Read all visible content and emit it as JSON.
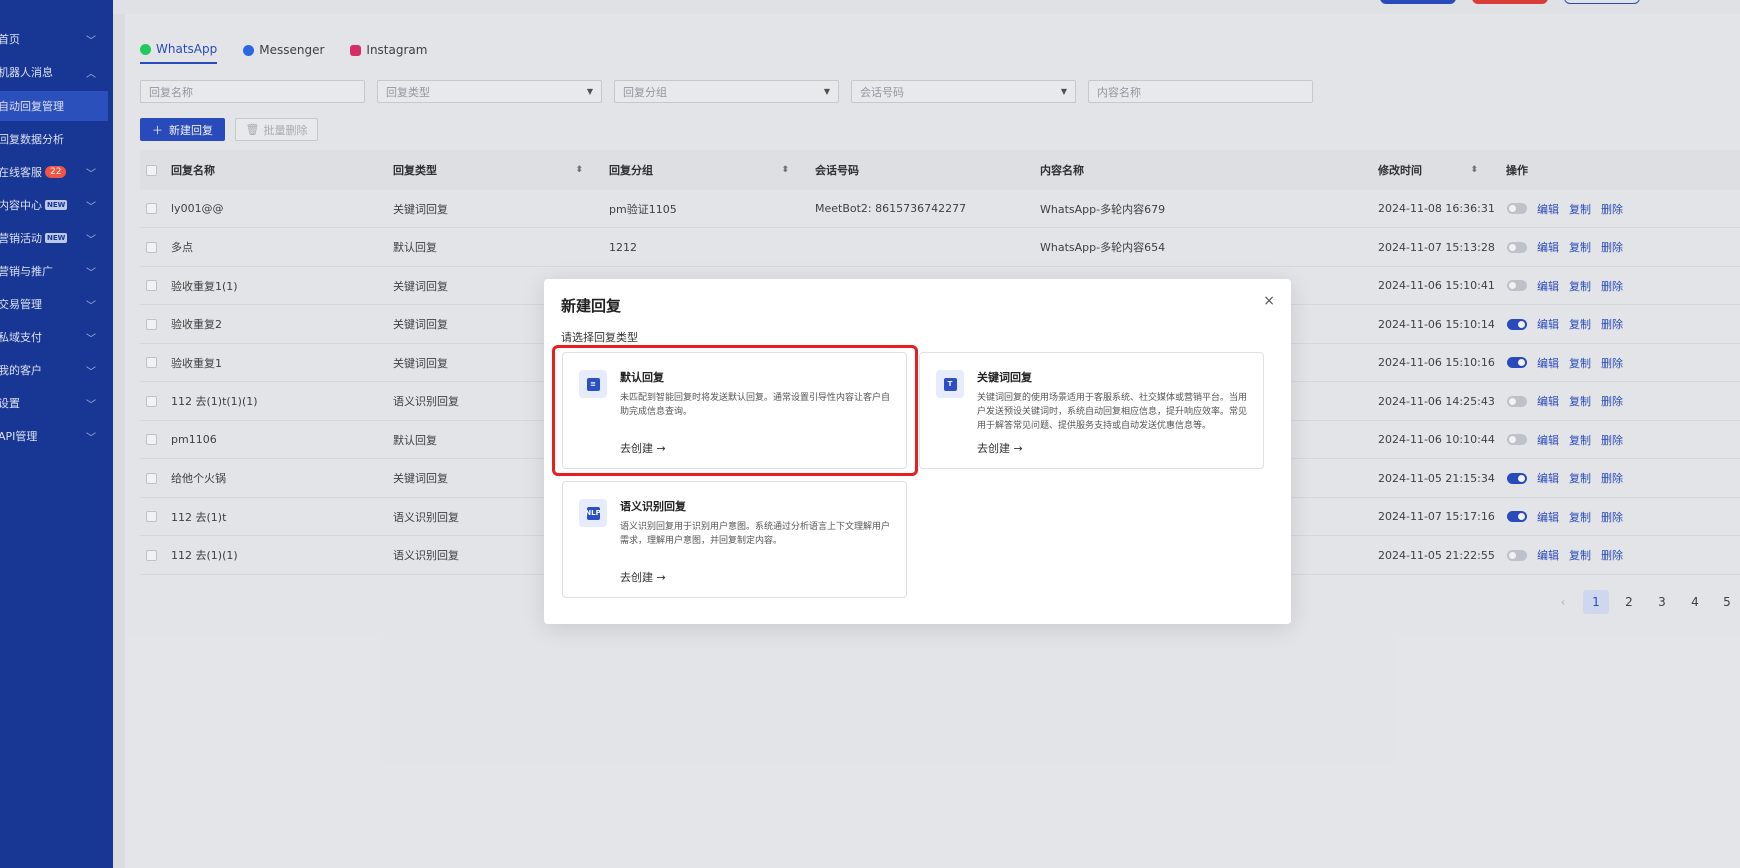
{
  "sidebar": {
    "items": [
      {
        "label": "首页",
        "chevron": "﹀"
      },
      {
        "label": "机器人消息",
        "chevron": "︿"
      },
      {
        "label": "自动回复管理",
        "chevron": ""
      },
      {
        "label": "回复数据分析",
        "chevron": ""
      },
      {
        "label": "在线客服",
        "badge": "22",
        "chevron": "﹀"
      },
      {
        "label": "内容中心",
        "new": "NEW",
        "chevron": "﹀"
      },
      {
        "label": "营销活动",
        "new": "NEW",
        "chevron": "﹀"
      },
      {
        "label": "营销与推广",
        "chevron": "﹀"
      },
      {
        "label": "交易管理",
        "chevron": "﹀"
      },
      {
        "label": "私域支付",
        "chevron": "﹀"
      },
      {
        "label": "我的客户",
        "chevron": "﹀"
      },
      {
        "label": "设置",
        "chevron": "﹀"
      },
      {
        "label": "API管理",
        "chevron": "﹀"
      }
    ]
  },
  "tabs": [
    {
      "label": "WhatsApp",
      "color": "#25d366"
    },
    {
      "label": "Messenger",
      "color": "#2b6ff0"
    },
    {
      "label": "Instagram",
      "color": "#e1306c"
    }
  ],
  "filters": {
    "name_placeholder": "回复名称",
    "type_placeholder": "回复类型",
    "group_placeholder": "回复分组",
    "number_placeholder": "会话号码",
    "content_placeholder": "内容名称"
  },
  "toolbar": {
    "new_label": "新建回复",
    "batch_delete_label": "批量删除"
  },
  "table": {
    "headers": {
      "name": "回复名称",
      "type": "回复类型",
      "group": "回复分组",
      "number": "会话号码",
      "content": "内容名称",
      "modified": "修改时间",
      "actions": "操作"
    },
    "rows": [
      {
        "name": "ly001@@",
        "type": "关键词回复",
        "group": "pm验证1105",
        "number": "MeetBot2: 8615736742277",
        "content": "WhatsApp-多轮内容679",
        "modified": "2024-11-08 16:36:31",
        "enabled": false
      },
      {
        "name": "多点",
        "type": "默认回复",
        "group": "1212",
        "number": "",
        "content": "WhatsApp-多轮内容654",
        "modified": "2024-11-07 15:13:28",
        "enabled": false
      },
      {
        "name": "验收重复1(1)",
        "type": "关键词回复",
        "group": "",
        "number": "",
        "content": "",
        "modified": "2024-11-06 15:10:41",
        "enabled": false
      },
      {
        "name": "验收重复2",
        "type": "关键词回复",
        "group": "",
        "number": "",
        "content": "",
        "modified": "2024-11-06 15:10:14",
        "enabled": true
      },
      {
        "name": "验收重复1",
        "type": "关键词回复",
        "group": "",
        "number": "",
        "content": "",
        "modified": "2024-11-06 15:10:16",
        "enabled": true
      },
      {
        "name": "112 去(1)t(1)(1)",
        "type": "语义识别回复",
        "group": "",
        "number": "",
        "content": "",
        "modified": "2024-11-06 14:25:43",
        "enabled": false
      },
      {
        "name": "pm1106",
        "type": "默认回复",
        "group": "",
        "number": "",
        "content": "",
        "modified": "2024-11-06 10:10:44",
        "enabled": false
      },
      {
        "name": "给他个火锅",
        "type": "关键词回复",
        "group": "",
        "number": "",
        "content": "",
        "modified": "2024-11-05 21:15:34",
        "enabled": true
      },
      {
        "name": "112 去(1)t",
        "type": "语义识别回复",
        "group": "",
        "number": "",
        "content": "",
        "modified": "2024-11-07 15:17:16",
        "enabled": true
      },
      {
        "name": "112 去(1)(1)",
        "type": "语义识别回复",
        "group": "",
        "number": "",
        "content": "",
        "modified": "2024-11-05 21:22:55",
        "enabled": false
      }
    ],
    "action_labels": {
      "edit": "编辑",
      "copy": "复制",
      "delete": "删除"
    }
  },
  "pagination": {
    "prev": "‹",
    "pages": [
      "1",
      "2",
      "3",
      "4",
      "5"
    ],
    "current": "1"
  },
  "modal": {
    "title": "新建回复",
    "close": "×",
    "subtitle": "请选择回复类型",
    "cards": [
      {
        "title": "默认回复",
        "desc": "未匹配到智能回复时将发送默认回复。通常设置引导性内容让客户自助完成信息查询。",
        "link": "去创建 →",
        "icon": "message-icon"
      },
      {
        "title": "关键词回复",
        "desc": "关键词回复的使用场景适用于客服系统、社交媒体或营销平台。当用户发送预设关键词时，系统自动回复相应信息，提升响应效率。常见用于解答常见问题、提供服务支持或自动发送优惠信息等。",
        "link": "去创建 →",
        "icon": "keyword-icon"
      },
      {
        "title": "语义识别回复",
        "desc": "语义识别回复用于识别用户意图。系统通过分析语言上下文理解用户需求，理解用户意图，并回复制定内容。",
        "link": "去创建 →",
        "icon": "nlp-icon"
      }
    ]
  },
  "colors": {
    "brand": "#2b4fc4",
    "sidebar": "#1a3a9c",
    "highlight": "#e5201e"
  }
}
